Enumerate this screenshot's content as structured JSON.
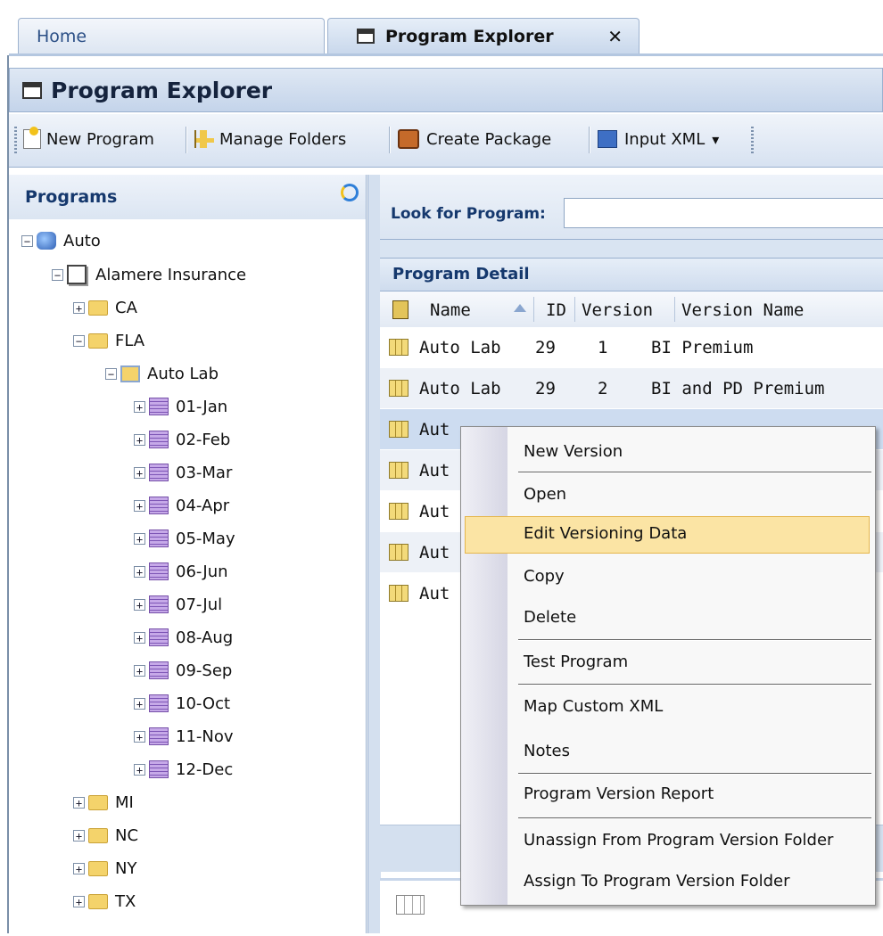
{
  "tabs": {
    "home": "Home",
    "active": "Program Explorer",
    "close": "✕"
  },
  "panel_title": "Program Explorer",
  "toolbar": {
    "new_program": "New Program",
    "manage_folders": "Manage Folders",
    "create_package": "Create Package",
    "input_xml": "Input XML",
    "dropdown": "▾"
  },
  "left": {
    "header": "Programs",
    "root": "Auto",
    "company": "Alamere Insurance",
    "states_top": [
      "CA",
      "FLA"
    ],
    "program": "Auto Lab",
    "months": [
      "01-Jan",
      "02-Feb",
      "03-Mar",
      "04-Apr",
      "05-May",
      "06-Jun",
      "07-Jul",
      "08-Aug",
      "09-Sep",
      "10-Oct",
      "11-Nov",
      "12-Dec"
    ],
    "states_bottom": [
      "MI",
      "NC",
      "NY",
      "TX"
    ]
  },
  "search": {
    "label": "Look for Program:",
    "value": ""
  },
  "detail": {
    "title": "Program Detail",
    "columns": {
      "name": "Name",
      "id": "ID",
      "version": "Version",
      "version_name": "Version Name"
    },
    "rows": [
      {
        "name": "Auto Lab",
        "id": "29",
        "version": "1",
        "version_name": "BI Premium"
      },
      {
        "name": "Auto Lab",
        "id": "29",
        "version": "2",
        "version_name": "BI and PD Premium"
      },
      {
        "name": "Aut",
        "id": "",
        "version": "",
        "version_name": ""
      },
      {
        "name": "Aut",
        "id": "",
        "version": "",
        "version_name": ""
      },
      {
        "name": "Aut",
        "id": "",
        "version": "",
        "version_name": ""
      },
      {
        "name": "Aut",
        "id": "",
        "version": "",
        "version_name": ""
      },
      {
        "name": "Aut",
        "id": "",
        "version": "",
        "version_name": ""
      }
    ]
  },
  "context_menu": [
    "New Version",
    "Open",
    "Edit Versioning Data",
    "Copy",
    "Delete",
    "Test Program",
    "Map Custom XML",
    "Notes",
    "Program Version Report",
    "Unassign From Program Version Folder",
    "Assign To Program Version Folder"
  ],
  "colors": {
    "accent": "#c4d4ea",
    "highlight": "#fbe4a4",
    "selected_row": "#cddcf0"
  }
}
